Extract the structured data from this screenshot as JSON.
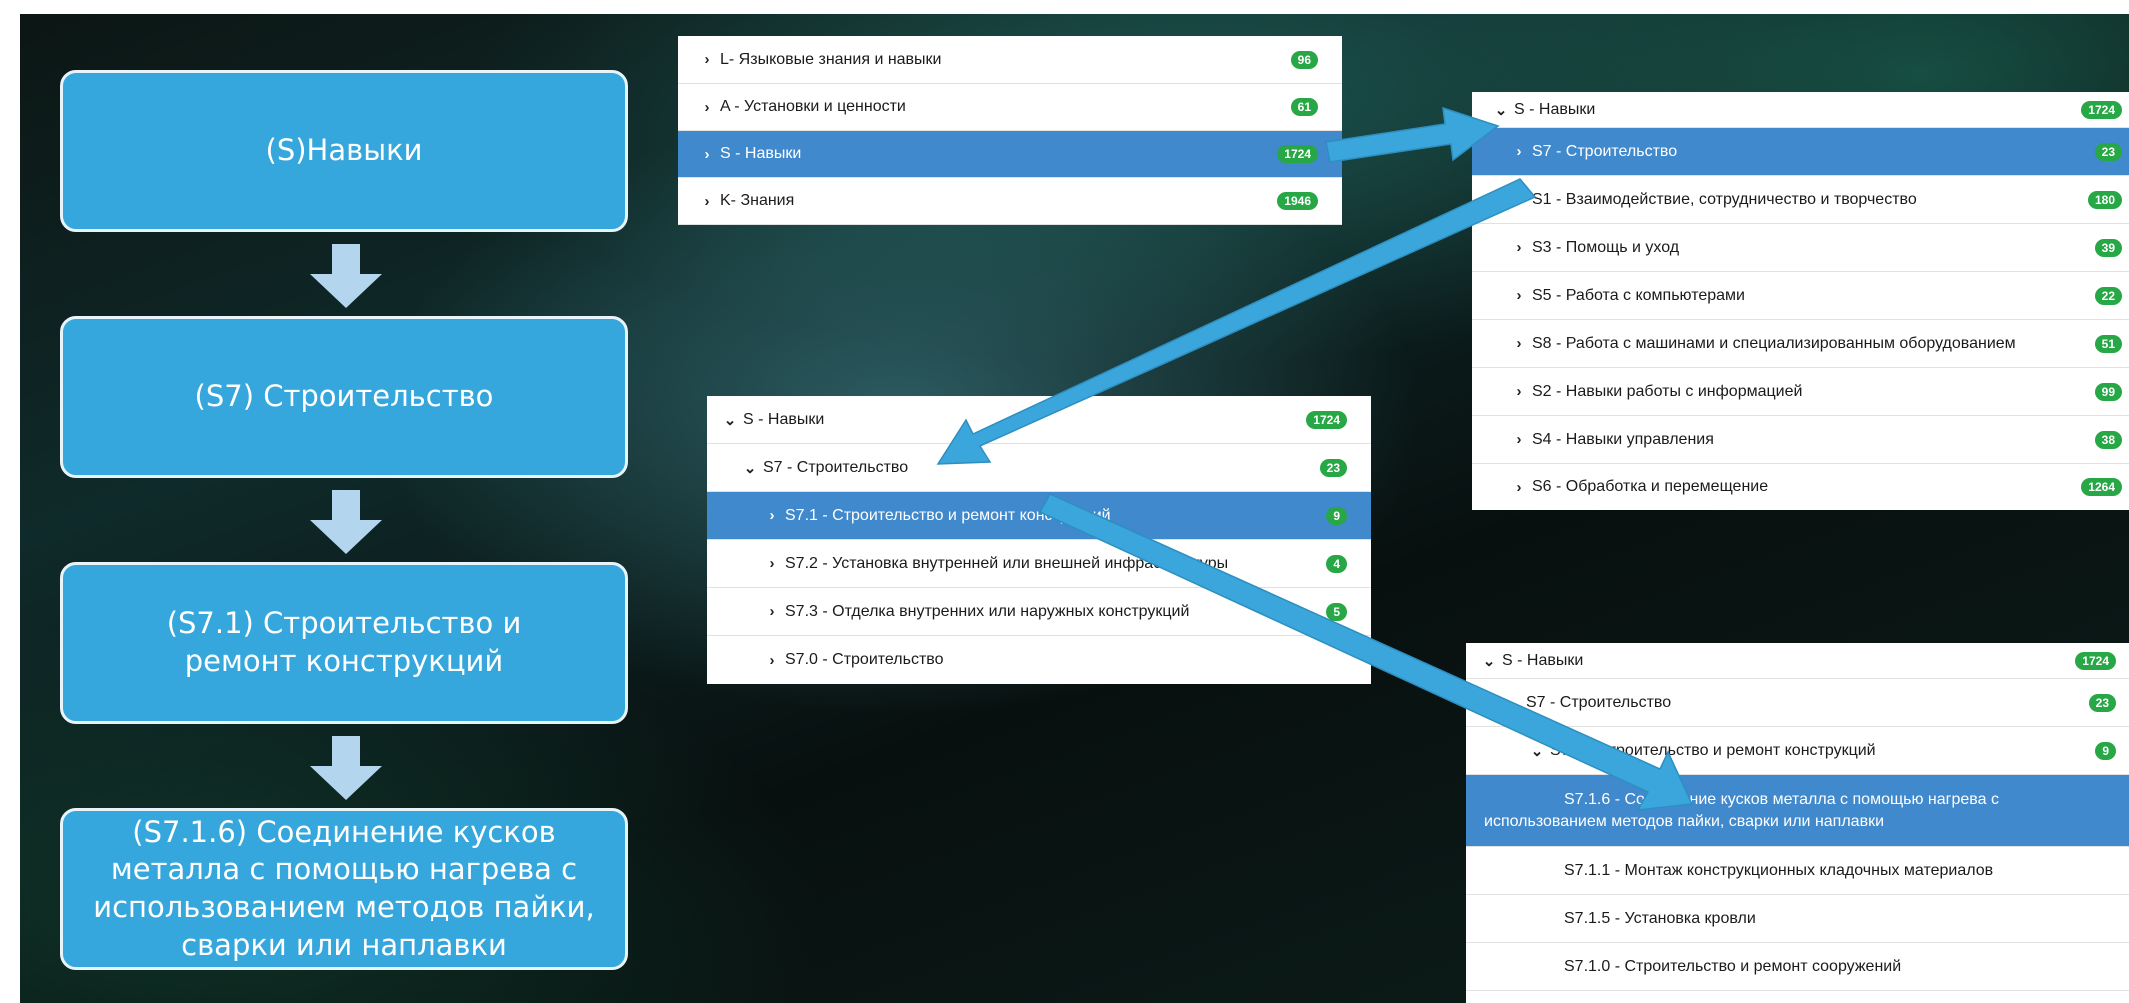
{
  "flow": {
    "step1": "(S)Навыки",
    "step2": "(S7) Строительство",
    "step3": "(S7.1) Строительство и ремонт конструкций",
    "step4": "(S7.1.6) Соединение кусков металла с помощью нагрева с использованием методов пайки, сварки или наплавки"
  },
  "panel_top": {
    "rows": [
      {
        "label": "L- Языковые знания и навыки",
        "count": "96"
      },
      {
        "label": "A - Установки и ценности",
        "count": "61"
      },
      {
        "label": "S - Навыки",
        "count": "1724"
      },
      {
        "label": "K- Знания",
        "count": "1946"
      }
    ]
  },
  "panel_right": {
    "rows": [
      {
        "label": "S - Навыки",
        "count": "1724"
      },
      {
        "label": "S7 - Строительство",
        "count": "23"
      },
      {
        "label": "S1 - Взаимодействие, сотрудничество и творчество",
        "count": "180"
      },
      {
        "label": "S3 - Помощь и уход",
        "count": "39"
      },
      {
        "label": "S5 - Работа с компьютерами",
        "count": "22"
      },
      {
        "label": "S8 - Работа с машинами и специализированным оборудованием",
        "count": "51"
      },
      {
        "label": "S2 - Навыки работы с информацией",
        "count": "99"
      },
      {
        "label": "S4 - Навыки управления",
        "count": "38"
      },
      {
        "label": "S6 - Обработка и перемещение",
        "count": "1264"
      }
    ]
  },
  "panel_mid": {
    "rows": [
      {
        "label": "S - Навыки",
        "count": "1724"
      },
      {
        "label": "S7 - Строительство",
        "count": "23"
      },
      {
        "label": "S7.1 - Строительство и ремонт конструкций",
        "count": "9"
      },
      {
        "label": "S7.2 - Установка внутренней или внешней инфраструктуры",
        "count": "4"
      },
      {
        "label": "S7.3 - Отделка внутренних или наружных конструкций",
        "count": "5"
      },
      {
        "label": "S7.0 - Строительство",
        "count": ""
      }
    ]
  },
  "panel_bottom": {
    "rows": [
      {
        "label": "S - Навыки",
        "count": "1724"
      },
      {
        "label": "S7 - Строительство",
        "count": "23"
      },
      {
        "label": "S7.1 - Строительство и ремонт конструкций",
        "count": "9"
      },
      {
        "label_line1": "S7.1.6 - Соединение кусков металла с помощью нагрева с",
        "label_line2": "использованием методов пайки, сварки или наплавки"
      },
      {
        "label": "S7.1.1 - Монтаж конструкционных кладочных материалов"
      },
      {
        "label": "S7.1.5 - Установка кровли"
      },
      {
        "label": "S7.1.0 - Строительство и ремонт сооружений"
      }
    ]
  },
  "colors": {
    "box": "#35a7dc",
    "selected_row": "#4089cc",
    "badge": "#27a745",
    "arrow": "#3aa6dc"
  }
}
